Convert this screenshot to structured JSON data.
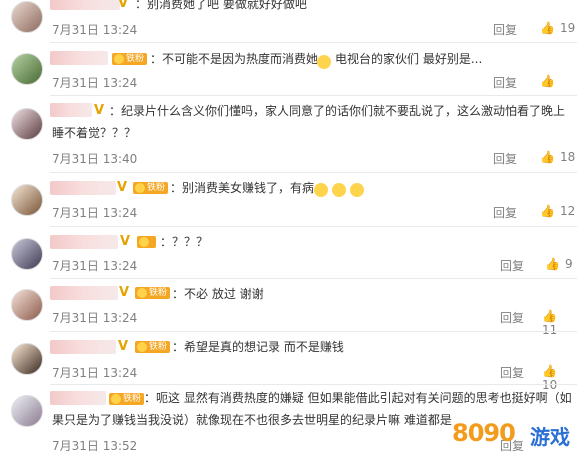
{
  "comments": [
    {
      "text": "：别消费她了吧 要做就好好做吧",
      "date": "7月31日 13:24",
      "reply": "回复",
      "likes": "19",
      "fan": ""
    },
    {
      "text": "：不可能不是因为热度而消费她",
      "text2": "电视台的家伙们 最好别是...",
      "date": "7月31日 13:24",
      "reply": "回复",
      "likes": "",
      "fan": "铁粉"
    },
    {
      "text": "：纪录片什么含义你们懂吗，家人同意了的话你们就不要乱说了，这么激动怕看了晚上",
      "line2": "睡不着觉？？？",
      "date": "7月31日 13:40",
      "reply": "回复",
      "likes": "18",
      "fan": ""
    },
    {
      "text": "：别消费美女赚钱了，有病",
      "date": "7月31日 13:24",
      "reply": "回复",
      "likes": "12",
      "fan": "铁粉"
    },
    {
      "text": "：？？？",
      "date": "7月31日 13:24",
      "reply": "回复",
      "likes": "9",
      "fan": ""
    },
    {
      "text": "：不必 放过 谢谢",
      "date": "7月31日 13:24",
      "reply": "回复",
      "likes": "11",
      "fan": "铁粉"
    },
    {
      "text": "：希望是真的想记录 而不是赚钱",
      "date": "7月31日 13:24",
      "reply": "回复",
      "likes": "10",
      "fan": "铁粉"
    },
    {
      "text": "：呃这 显然有消费热度的嫌疑 但如果能借此引起对有关问题的思考也挺好啊（如",
      "line2": "果只是为了赚钱当我没说）就像现在不也很多去世明星的纪录片嘛 难道都是",
      "date": "7月31日 13:52",
      "reply": "回复",
      "likes": "",
      "fan": "铁粉"
    }
  ],
  "watermark": {
    "logo": "8090",
    "text": "游戏"
  }
}
